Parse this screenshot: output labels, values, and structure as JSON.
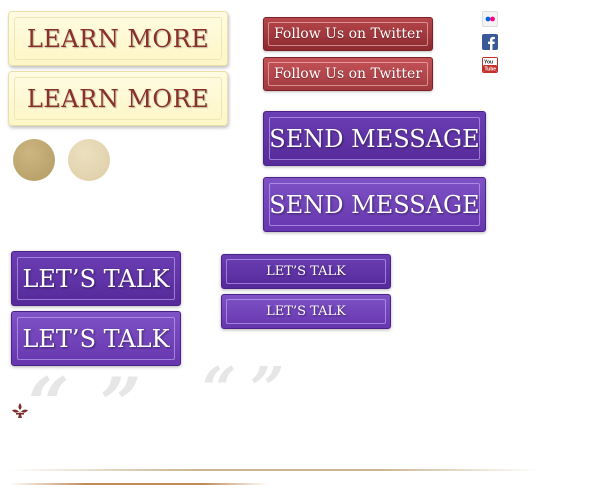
{
  "buttons": {
    "learn_more": [
      "LEARN MORE",
      "LEARN MORE"
    ],
    "twitter": [
      "Follow Us on Twitter",
      "Follow Us on Twitter"
    ],
    "send_message": [
      "SEND MESSAGE",
      "SEND MESSAGE"
    ],
    "lets_talk_large": [
      "LET’S TALK",
      "LET’S TALK"
    ],
    "lets_talk_small": [
      "LET’S TALK",
      "LET’S TALK"
    ]
  },
  "quotes": {
    "open": "“",
    "close": "”"
  },
  "icons": [
    "flickr-icon",
    "facebook-icon",
    "youtube-icon",
    "fleur-ornament-icon"
  ],
  "colors": {
    "cream_text": "#8a2f2a",
    "twitter_red": "#9a3338",
    "purple": "#5e30a6",
    "gold_dark": "#bba36c",
    "gold_light": "#e5d6b0"
  }
}
